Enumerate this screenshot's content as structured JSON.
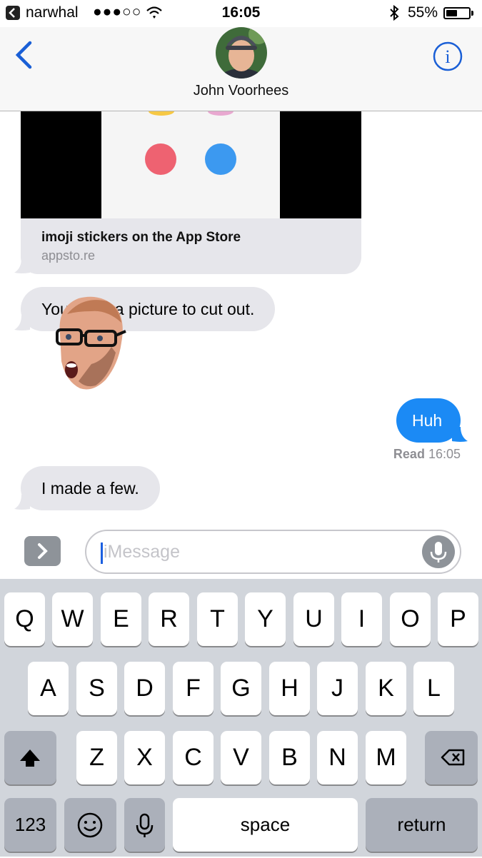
{
  "status_bar": {
    "carrier": "narwhal",
    "signal": "●●●○○",
    "time": "16:05",
    "battery_percent": "55%",
    "battery_level": 0.55
  },
  "header": {
    "contact_name": "John Voorhees",
    "back_icon": "chevron-left-icon",
    "info_icon": "info-icon"
  },
  "conversation": {
    "link_card": {
      "title": "imoji stickers on the App Store",
      "domain": "appsto.re"
    },
    "messages": [
      {
        "from": "them",
        "text": "You need a picture to cut out."
      },
      {
        "from": "me",
        "text": "Huh"
      },
      {
        "from": "them",
        "text": "I made a few."
      }
    ],
    "read_label": "Read",
    "read_time": "16:05"
  },
  "input": {
    "placeholder": "iMessage"
  },
  "keyboard": {
    "row1": [
      "Q",
      "W",
      "E",
      "R",
      "T",
      "Y",
      "U",
      "I",
      "O",
      "P"
    ],
    "row2": [
      "A",
      "S",
      "D",
      "F",
      "G",
      "H",
      "J",
      "K",
      "L"
    ],
    "row3": [
      "Z",
      "X",
      "C",
      "V",
      "B",
      "N",
      "M"
    ],
    "numbers_label": "123",
    "space_label": "space",
    "return_label": "return"
  },
  "colors": {
    "imessage_blue": "#1b8af5",
    "incoming_bubble": "#e6e6eb",
    "nav_blue": "#1a5fd6",
    "keyboard_bg": "#d1d5db"
  }
}
